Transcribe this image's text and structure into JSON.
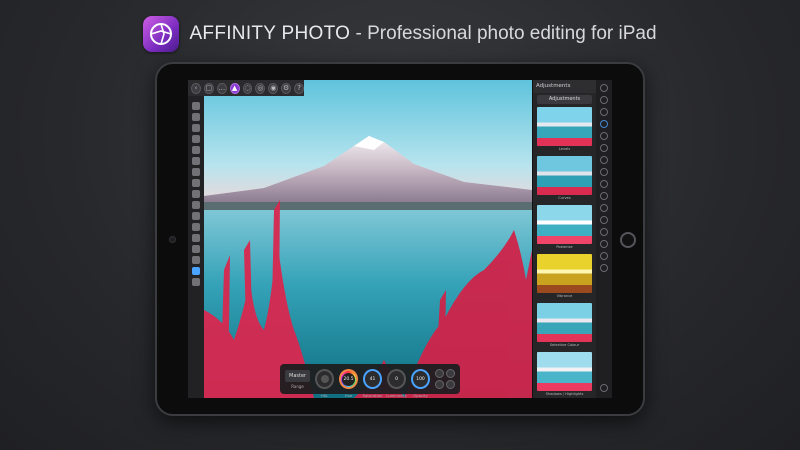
{
  "header": {
    "brand": "AFFINITY PHOTO",
    "separator": " - ",
    "tagline": "Professional photo editing for iPad"
  },
  "studio": {
    "panel_title": "Adjustments",
    "selector": "Adjustments",
    "presets": [
      {
        "label": "Levels"
      },
      {
        "label": "Curves"
      },
      {
        "label": "Posterize"
      },
      {
        "label": "Vibrance"
      },
      {
        "label": "Selective Colour"
      },
      {
        "label": "Shadows / Highlights"
      }
    ]
  },
  "context_bar": {
    "master_label": "Master",
    "range_label": "Range",
    "hsl_label": "HSL",
    "hue_label": "Hue",
    "hue_value": "20.5",
    "saturation_label": "Saturation",
    "saturation_value": "41",
    "luminosity_label": "Luminosity",
    "luminosity_value": "0",
    "opacity_label": "Opacity",
    "opacity_value": "100"
  },
  "colors": {
    "accent": "#4aa3ff",
    "brand": "#8a3ad0",
    "sky": "#7fd0e6",
    "water": "#2aa3b6",
    "foliage": "#e0305a"
  },
  "icons": {
    "logo": "affinity-photo-logo-icon",
    "move_tool": "move-tool-icon",
    "brush_tool": "brush-tool-icon"
  }
}
